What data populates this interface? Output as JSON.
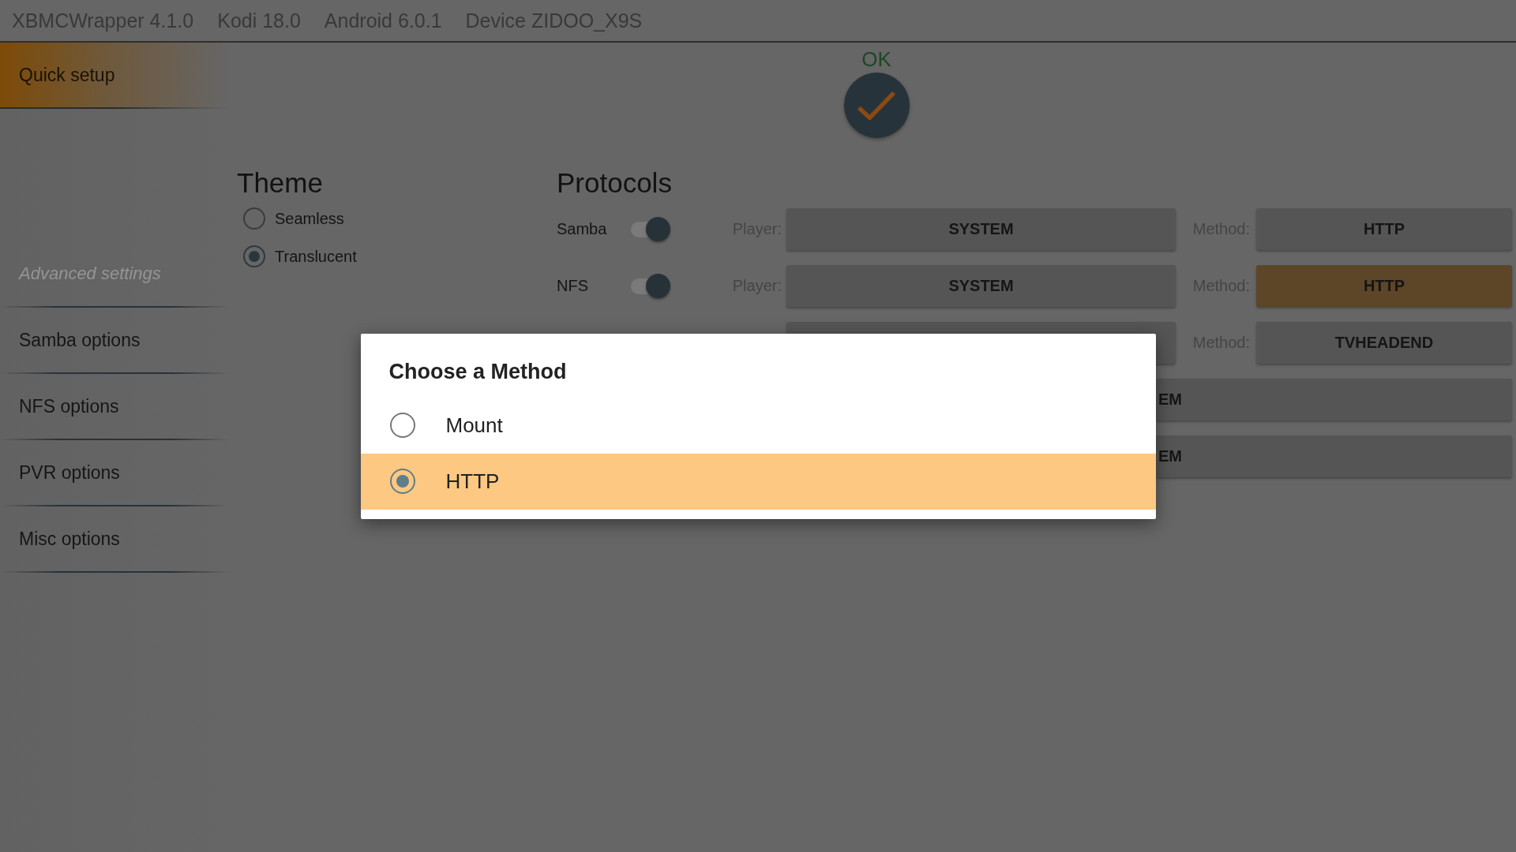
{
  "top_bar": {
    "items": [
      "XBMCWrapper 4.1.0",
      "Kodi 18.0",
      "Android 6.0.1",
      "Device ZIDOO_X9S"
    ]
  },
  "sidebar": {
    "items": [
      {
        "label": "Quick setup",
        "selected": true
      }
    ],
    "advanced": {
      "heading": "Advanced settings",
      "items": [
        {
          "label": "Samba options",
          "selected": false
        },
        {
          "label": "NFS options",
          "selected": false
        },
        {
          "label": "PVR options",
          "selected": false
        },
        {
          "label": "Misc options",
          "selected": false
        }
      ]
    }
  },
  "ok_button": {
    "label": "OK"
  },
  "theme": {
    "title": "Theme",
    "options": [
      {
        "label": "Seamless",
        "selected": false
      },
      {
        "label": "Translucent",
        "selected": true
      }
    ]
  },
  "protocols": {
    "title": "Protocols",
    "rows": [
      {
        "kind": "full",
        "name": "Samba",
        "on": true,
        "player_label": "Player:",
        "player": "SYSTEM",
        "method_label": "Method:",
        "method": {
          "value": "HTTP",
          "focused": false
        }
      },
      {
        "kind": "full",
        "name": "NFS",
        "on": true,
        "player_label": "Player:",
        "player": "SYSTEM",
        "method_label": "Method:",
        "method": {
          "value": "HTTP",
          "focused": true
        }
      },
      {
        "kind": "covered",
        "method_label": "Method:",
        "method": {
          "value": "TVHEADEND",
          "focused": false
        }
      },
      {
        "kind": "wide",
        "value": "EM"
      },
      {
        "kind": "wide",
        "value": "EM"
      }
    ]
  },
  "dialog": {
    "title": "Choose a Method",
    "options": [
      {
        "label": "Mount",
        "selected": false,
        "focused": false
      },
      {
        "label": "HTTP",
        "selected": true,
        "focused": true
      }
    ]
  }
}
